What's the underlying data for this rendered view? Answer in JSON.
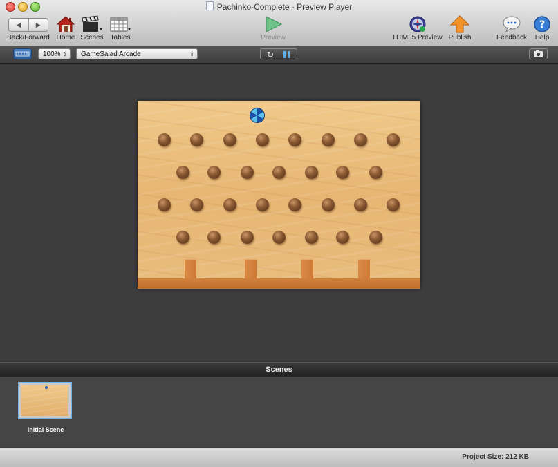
{
  "window": {
    "title": "Pachinko-Complete - Preview Player"
  },
  "toolbar": {
    "back_forward_label": "Back/Forward",
    "home_label": "Home",
    "scenes_label": "Scenes",
    "tables_label": "Tables",
    "preview_label": "Preview",
    "html5_preview_label": "HTML5 Preview",
    "publish_label": "Publish",
    "feedback_label": "Feedback",
    "help_label": "Help"
  },
  "subbar": {
    "zoom_value": "100%",
    "device_value": "GameSalad Arcade"
  },
  "stage": {
    "floor_posts": 4,
    "peg_rows": [
      8,
      7,
      8,
      7
    ]
  },
  "scenes_panel": {
    "header": "Scenes",
    "items": [
      {
        "label": "Initial Scene"
      }
    ]
  },
  "status": {
    "project_size": "Project Size: 212 KB"
  },
  "colors": {
    "wood": "#e7b673",
    "peg": "#7a4a26",
    "ball_dark": "#1a4fa8",
    "ball_light": "#5cc0ec",
    "selection_border": "#6fb3e6"
  }
}
